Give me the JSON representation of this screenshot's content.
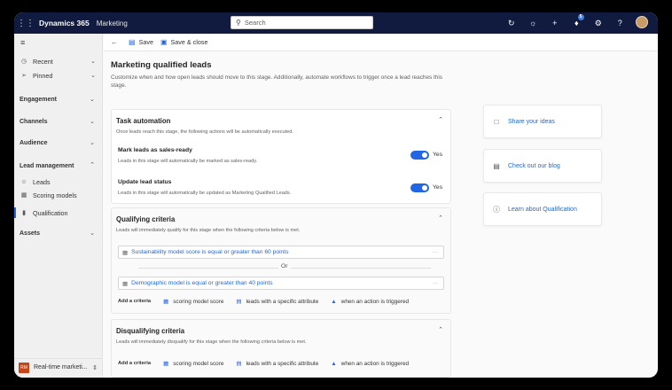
{
  "topbar": {
    "brand": "Dynamics 365",
    "app": "Marketing",
    "search_placeholder": "Search",
    "notification_count": "5"
  },
  "sidebar": {
    "items": [
      {
        "label": "Recent",
        "icon": "clock-icon"
      },
      {
        "label": "Pinned",
        "icon": "pin-icon"
      }
    ],
    "groups": [
      {
        "label": "Engagement"
      },
      {
        "label": "Channels"
      },
      {
        "label": "Audience"
      },
      {
        "label": "Lead management"
      },
      {
        "label": "Assets"
      }
    ],
    "lead_items": [
      {
        "label": "Leads",
        "icon": "leads-icon"
      },
      {
        "label": "Scoring models",
        "icon": "scoring-icon"
      },
      {
        "label": "Qualification",
        "icon": "qualification-icon",
        "active": true
      }
    ],
    "area": {
      "badge": "RM",
      "label": "Real-time marketi..."
    }
  },
  "cmdbar": {
    "save": "Save",
    "save_close": "Save & close"
  },
  "page": {
    "title": "Marketing qualified leads",
    "description": "Customize when and how open leads should move to this stage. Additionally, automate workflows to trigger once a lead reaches this stage."
  },
  "task_automation": {
    "title": "Task automation",
    "subtitle": "Once leads reach this stage, the following actions will be automatically executed.",
    "rows": [
      {
        "title": "Mark leads as sales-ready",
        "desc": "Leads in this stage will automatically be marked as sales-ready.",
        "toggle": "Yes"
      },
      {
        "title": "Update lead status",
        "desc": "Leads in this stage will automatically be updated as Marketing Qualified Leads.",
        "toggle": "Yes"
      }
    ]
  },
  "qualifying": {
    "title": "Qualifying criteria",
    "subtitle": "Leads will immediately qualify for this stage when the following criteria below is met.",
    "criteria": [
      "Sustainability model score is equal or greater than 60 points",
      "Demographic model is equal or greater than 40 points"
    ],
    "or_label": "Or",
    "more": "···"
  },
  "add_criteria": {
    "label": "Add a criteria",
    "options": [
      "scoring model score",
      "leads with a specific attribute",
      "when an action is triggered"
    ]
  },
  "disqualifying": {
    "title": "Disqualifying criteria",
    "subtitle": "Leads will immediately disqualify for this stage when the following criteria below is met."
  },
  "side_links": [
    {
      "label": "Share your ideas",
      "icon": "feedback-icon"
    },
    {
      "label": "Check out our blog",
      "icon": "blog-icon"
    },
    {
      "label": "Learn about Qualification",
      "icon": "help-icon"
    }
  ],
  "colors": {
    "accent": "#2266e3",
    "topbar": "#101b3f",
    "area_badge": "#c4461b"
  }
}
